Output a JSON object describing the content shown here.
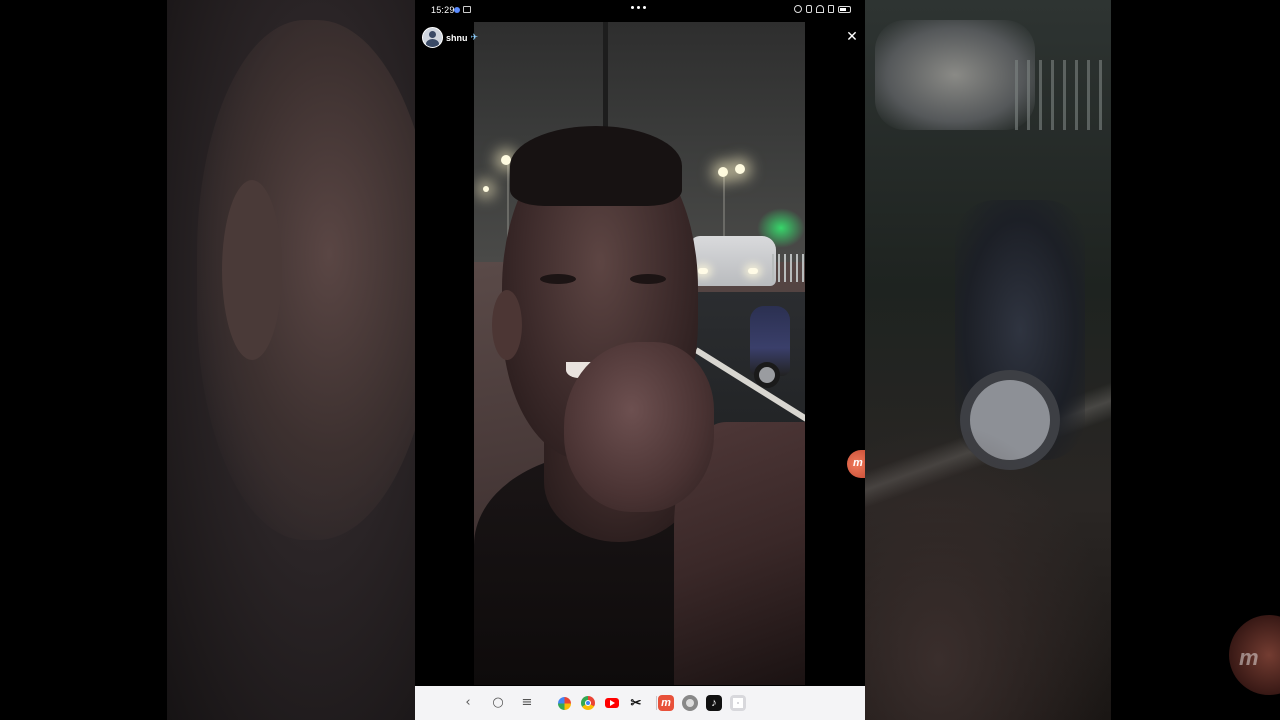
{
  "status_bar": {
    "time": "15:29",
    "battery_level": 0.5
  },
  "story": {
    "username": "shnu",
    "verified_glyph": "✈",
    "close_glyph": "✕"
  },
  "nav_bar": {
    "back_glyph": "‹",
    "home_glyph": "○",
    "recents_glyph": "≡",
    "dock_apps": [
      "photos",
      "chrome",
      "youtube",
      "capcut",
      "mobizen",
      "settings",
      "tiktok",
      "app-grid"
    ]
  },
  "overlay": {
    "recorder_bubble_glyph": "m",
    "watermark_glyph": "m"
  },
  "colors": {
    "nav_background": "#f4f4f6",
    "bubble_accent": "#e8513a",
    "status_dot": "#5b8cff"
  }
}
